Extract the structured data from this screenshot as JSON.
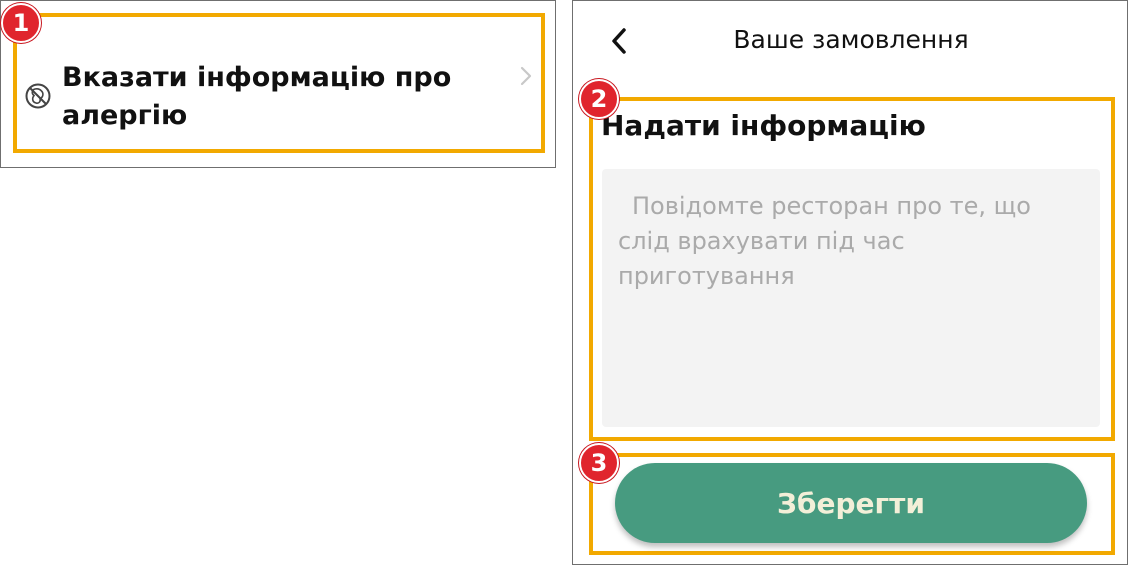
{
  "colors": {
    "highlight": "#f2a900",
    "badge": "#e0252d",
    "button": "#479b80",
    "button_text": "#f3efd8",
    "textarea_bg": "#f3f3f3"
  },
  "callouts": [
    "1",
    "2",
    "3"
  ],
  "allergy_row": {
    "icon": "no-peanut-icon",
    "label": "Вказати інформацію про алергію",
    "chevron": "chevron-right-icon"
  },
  "order_screen": {
    "back_icon": "chevron-left-icon",
    "title": "Ваше замовлення",
    "section_heading": "Надати інформацію",
    "notes_input": {
      "value": "",
      "placeholder": "Повідомте ресторан про те, що слід врахувати під час приготування"
    },
    "save_label": "Зберегти"
  }
}
